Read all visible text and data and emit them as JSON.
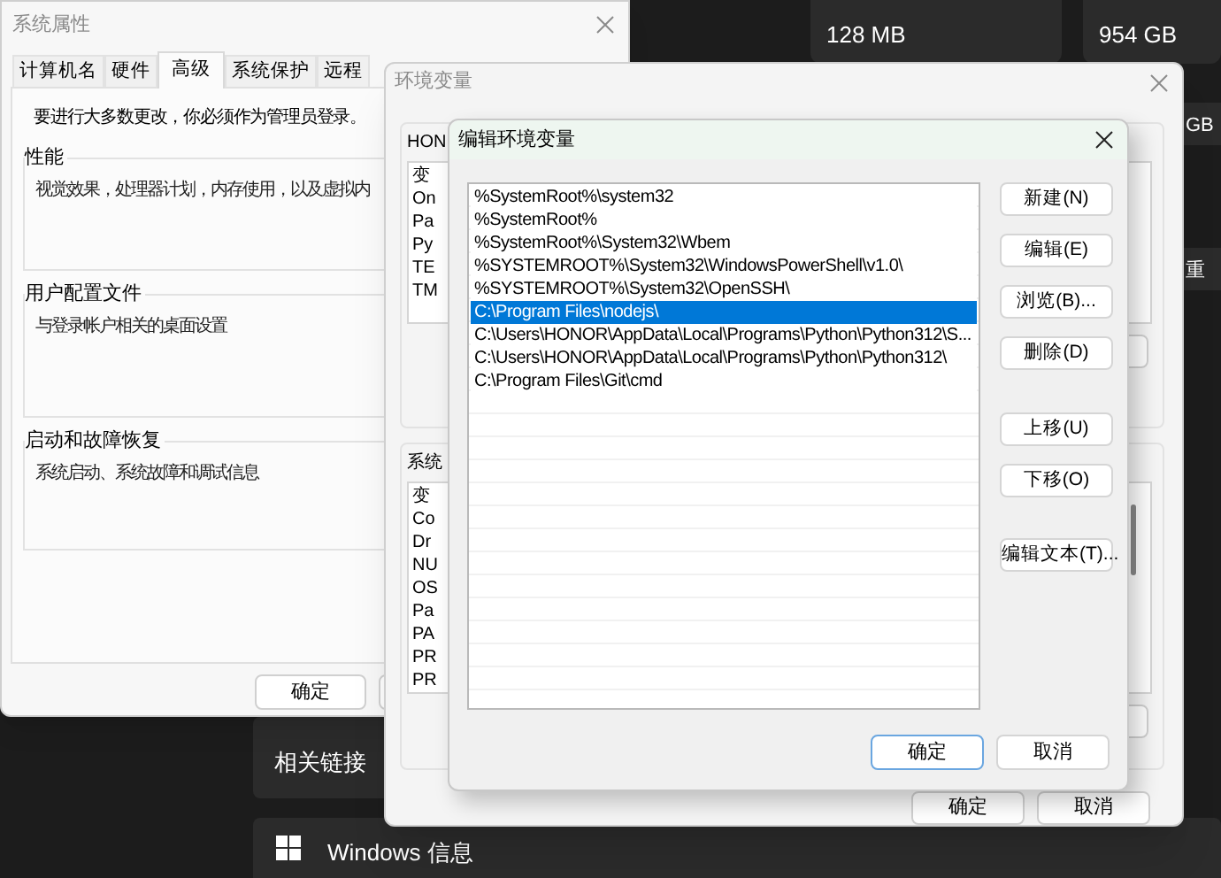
{
  "desktop": {
    "cards": [
      {
        "value": "128 MB"
      },
      {
        "value": "954 GB"
      }
    ],
    "side_texts": [
      "GB",
      "重"
    ],
    "related_links": {
      "label": "相关链接"
    },
    "windows_info": {
      "label": "Windows 信息"
    }
  },
  "system_properties": {
    "title": "系统属性",
    "tabs": [
      {
        "label": "计算机名",
        "selected": false
      },
      {
        "label": "硬件",
        "selected": false
      },
      {
        "label": "高级",
        "selected": true
      },
      {
        "label": "系统保护",
        "selected": false
      },
      {
        "label": "远程",
        "selected": false
      }
    ],
    "notice": "要进行大多数更改，你必须作为管理员登录。",
    "groups": [
      {
        "title": "性能",
        "text": "视觉效果，处理器计划，内存使用，以及虚拟内"
      },
      {
        "title": "用户配置文件",
        "text": "与登录帐户相关的桌面设置"
      },
      {
        "title": "启动和故障恢复",
        "text": "系统启动、系统故障和调试信息"
      }
    ],
    "ok_button": "确定"
  },
  "environment_variables": {
    "title": "环境变量",
    "user_label": "HON",
    "user_header": "变",
    "user_rows": [
      "On",
      "Pa",
      "Py",
      "TE",
      "TM"
    ],
    "system_label": "系统",
    "system_header": "变",
    "system_rows": [
      "Co",
      "Dr",
      "NU",
      "OS",
      "Pa",
      "PA",
      "PR",
      "PR"
    ],
    "buttons": [
      "确定",
      "取消"
    ]
  },
  "edit_dialog": {
    "title": "编辑环境变量",
    "entries": [
      {
        "text": "%SystemRoot%\\system32",
        "selected": false
      },
      {
        "text": "%SystemRoot%",
        "selected": false
      },
      {
        "text": "%SystemRoot%\\System32\\Wbem",
        "selected": false
      },
      {
        "text": "%SYSTEMROOT%\\System32\\WindowsPowerShell\\v1.0\\",
        "selected": false
      },
      {
        "text": "%SYSTEMROOT%\\System32\\OpenSSH\\",
        "selected": false
      },
      {
        "text": "C:\\Program Files\\nodejs\\",
        "selected": true
      },
      {
        "text": "C:\\Users\\HONOR\\AppData\\Local\\Programs\\Python\\Python312\\S...",
        "selected": false
      },
      {
        "text": "C:\\Users\\HONOR\\AppData\\Local\\Programs\\Python\\Python312\\",
        "selected": false
      },
      {
        "text": "C:\\Program Files\\Git\\cmd",
        "selected": false
      }
    ],
    "side_buttons": [
      "新建(N)",
      "编辑(E)",
      "浏览(B)...",
      "删除(D)",
      "上移(U)",
      "下移(O)",
      "编辑文本(T)..."
    ],
    "ok_button": "确定",
    "cancel_button": "取消"
  }
}
